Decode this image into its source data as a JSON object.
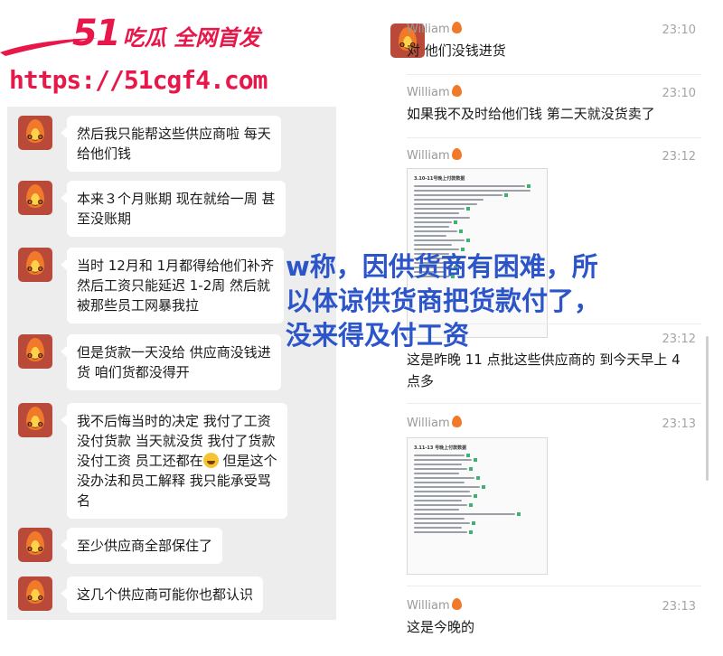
{
  "watermark": {
    "brand_number": "51",
    "brand_text": "吃瓜 全网首发",
    "url": "https://51cgf4.com"
  },
  "left_chat": {
    "messages": [
      {
        "lines": [
          "然后我只能帮这些供应商啦 每天",
          "给他们钱"
        ]
      },
      {
        "lines": [
          "本来３个月账期 现在就给一周 甚",
          "至没账期"
        ]
      },
      {
        "lines": [
          "当时 12月和 1月都得给他们补齐",
          "然后工资只能延迟 1-2周 然后就",
          "被那些员工网暴我拉"
        ]
      },
      {
        "lines": [
          "但是货款一天没给 供应商没钱进",
          "货 咱们货都没得开"
        ]
      },
      {
        "lines": [
          "我不后悔当时的决定 我付了工资",
          "没付货款 当天就没货 我付了货款",
          "没付工资 员工还都在"
        ],
        "after_emoji": "但是这个",
        "more": [
          "没办法和员工解释 我只能承受骂",
          "名"
        ]
      },
      {
        "lines": [
          "至少供应商全部保住了"
        ]
      },
      {
        "lines": [
          "这几个供应商可能你也都认识"
        ]
      }
    ]
  },
  "right_chat": {
    "sender": "William",
    "messages": [
      {
        "time": "23:10",
        "text": "对 他们没钱进货"
      },
      {
        "time": "23:10",
        "text": "如果我不及时给他们钱 第二天就没货卖了"
      },
      {
        "time": "23:12",
        "image_title": "3.10-11号晚上付款数据"
      },
      {
        "time": "23:12",
        "text": "这是昨晚 11 点批这些供应商的 到今天早上 4 点多"
      },
      {
        "time": "23:13",
        "image_title": "3.11-13 号晚上付款数据"
      },
      {
        "time": "23:13",
        "text": "这是今晚的"
      }
    ]
  },
  "caption": {
    "lines": [
      "w称，因供货商有困难，所",
      "以体谅供货商把货款付了，",
      "没来得及付工资"
    ]
  },
  "colors": {
    "watermark": "#e8174a",
    "caption": "#2b55c9",
    "left_panel_bg": "#ededed"
  }
}
